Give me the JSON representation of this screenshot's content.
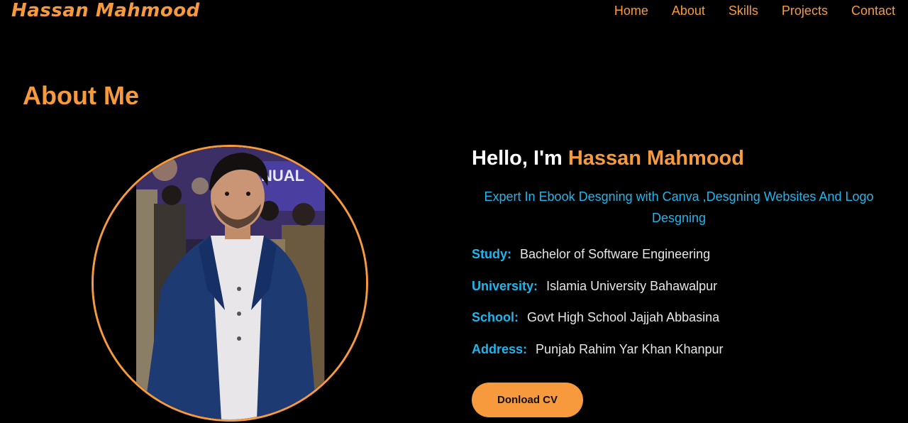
{
  "header": {
    "logo": "Hassan Mahmood",
    "nav": [
      "Home",
      "About",
      "Skills",
      "Projects",
      "Contact"
    ]
  },
  "about": {
    "title": "About Me",
    "greeting_prefix": "Hello, I'm",
    "name": "Hassan Mahmood",
    "tagline": "Expert In Ebook Desgning with Canva ,Desgning Websites And Logo Desgning",
    "details": [
      {
        "label": "Study:",
        "value": "Bachelor of Software Engineering"
      },
      {
        "label": "University:",
        "value": "Islamia University Bahawalpur"
      },
      {
        "label": "School:",
        "value": "Govt High School Jajjah Abbasina"
      },
      {
        "label": "Address:",
        "value": "Punjab Rahim Yar Khan Khanpur"
      }
    ],
    "cv_button": "Donload CV"
  },
  "colors": {
    "accent": "#f79a3e",
    "highlight": "#1fb6ee",
    "background": "#000000"
  }
}
